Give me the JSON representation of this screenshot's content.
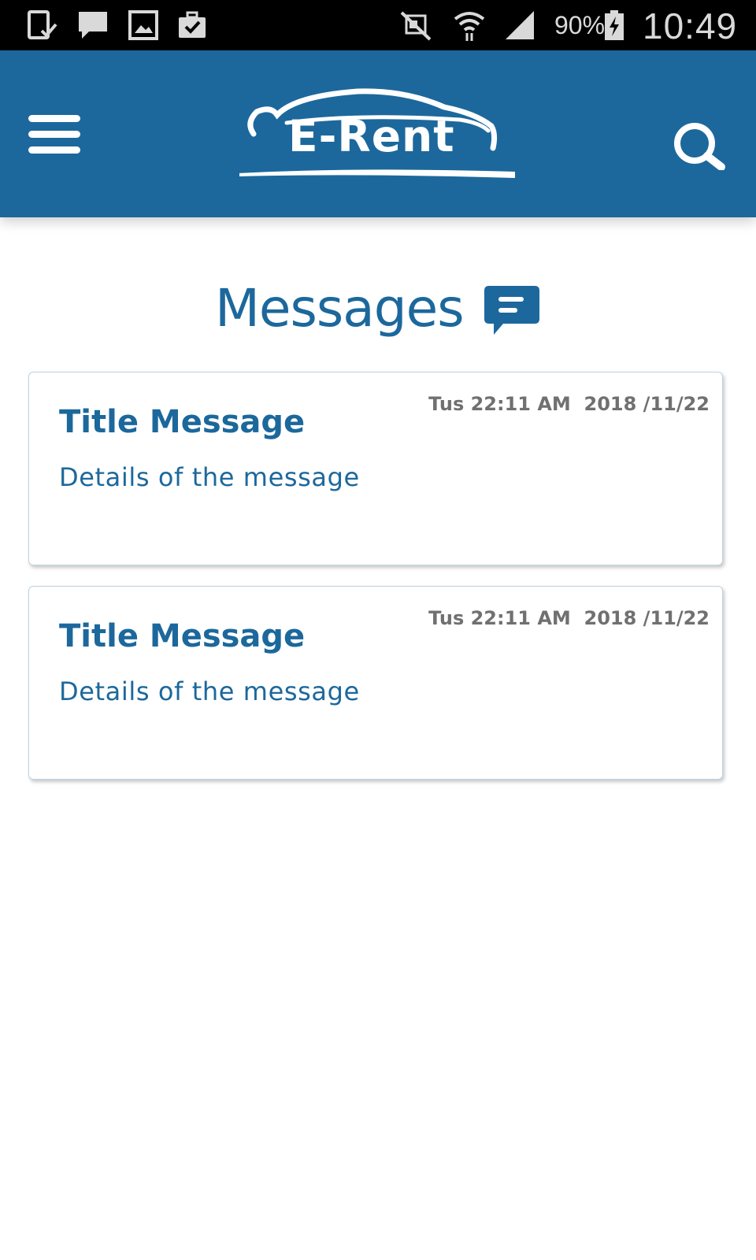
{
  "status_bar": {
    "battery_percent": "90%",
    "time": "10:49",
    "left_icons": [
      "device-check-icon",
      "chat-notification-icon",
      "image-icon",
      "briefcase-check-icon"
    ],
    "right_icons": [
      "mute-icon",
      "wifi-icon",
      "signal-icon",
      "battery-charging-icon"
    ]
  },
  "header": {
    "logo_text": "E-Rent",
    "background_color": "#1c689c",
    "menu_icon": "hamburger-menu-icon",
    "search_icon": "search-icon"
  },
  "page": {
    "title": "Messages",
    "title_icon": "message-bubble-icon"
  },
  "messages": [
    {
      "date": "Tus 22:11 AM  2018 /11/22",
      "title": "Title Message",
      "details": "Details of the message"
    },
    {
      "date": "Tus 22:11 AM  2018 /11/22",
      "title": "Title Message",
      "details": "Details of the message"
    }
  ]
}
